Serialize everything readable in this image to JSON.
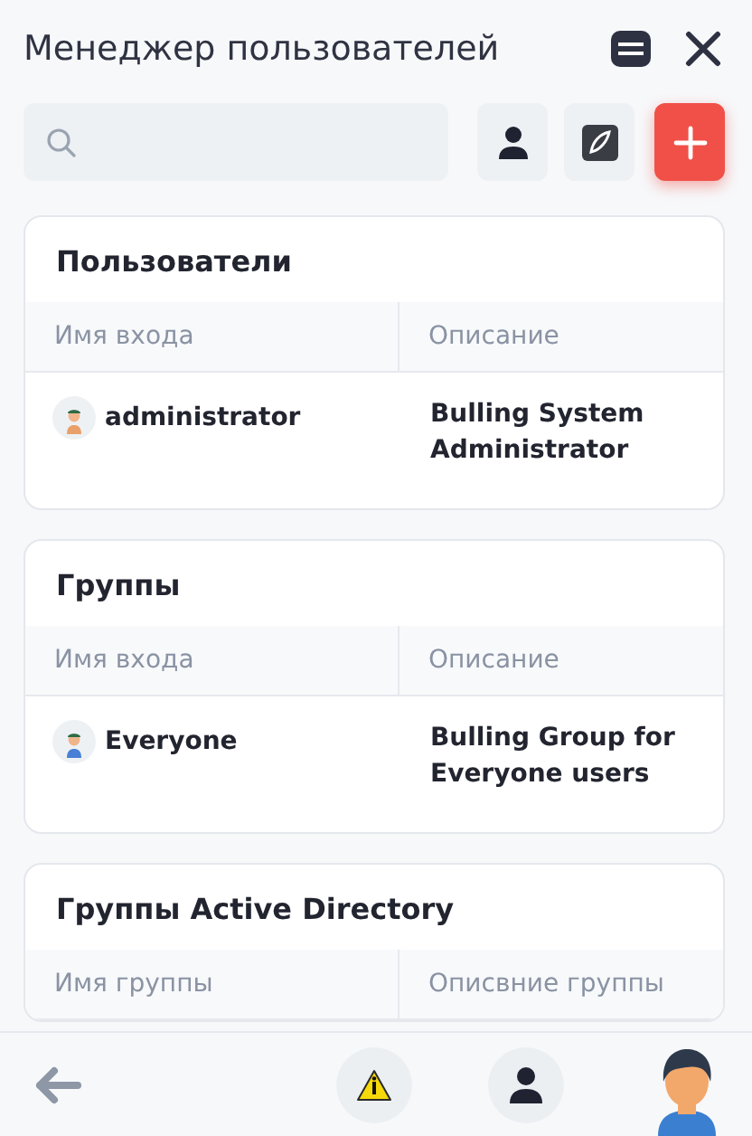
{
  "title": "Менеджер пользователей",
  "sections": [
    {
      "title": "Пользователи",
      "columns": [
        "Имя входа",
        "Описание"
      ],
      "rows": [
        {
          "name": "administrator",
          "description": "Bulling System Administrator",
          "kind": "user"
        }
      ]
    },
    {
      "title": "Группы",
      "columns": [
        "Имя входа",
        "Описание"
      ],
      "rows": [
        {
          "name": "Everyone",
          "description": "Bulling Group for Everyone users",
          "kind": "group"
        }
      ]
    },
    {
      "title": "Группы Active Directory",
      "columns": [
        "Имя группы",
        "Описвние группы"
      ]
    }
  ]
}
